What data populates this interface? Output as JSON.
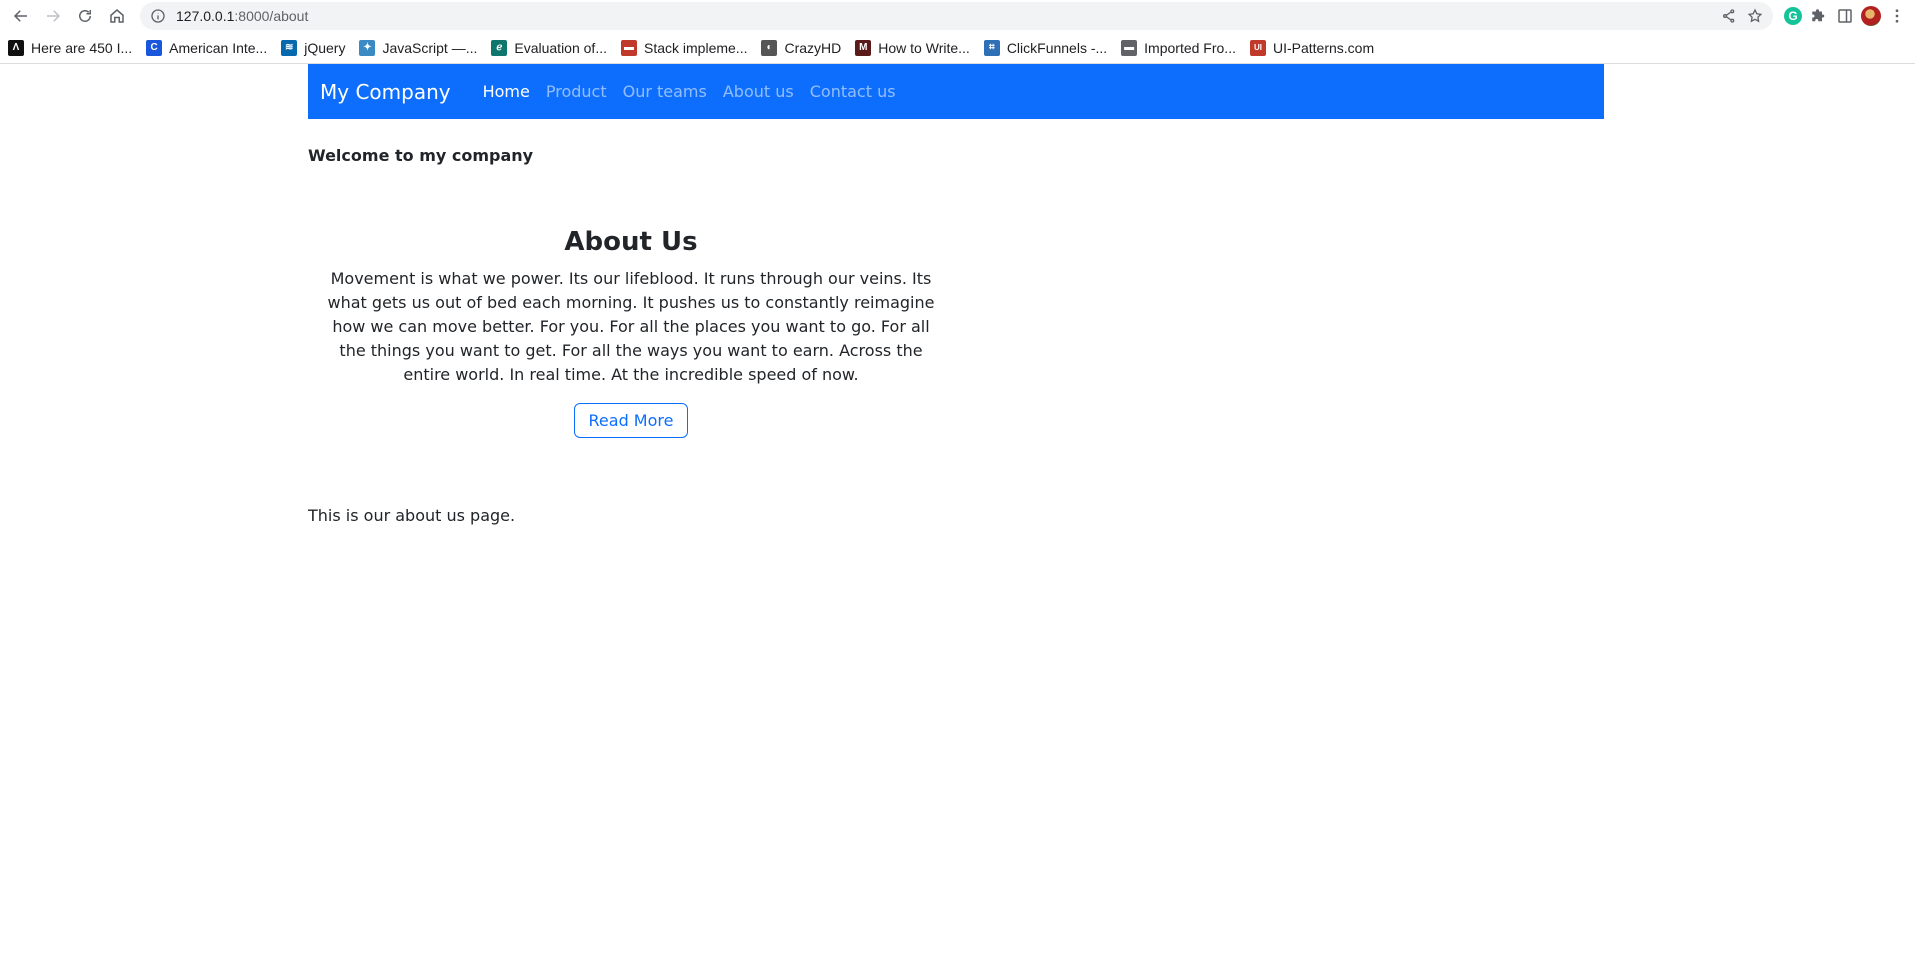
{
  "browser": {
    "url_host": "127.0.0.1",
    "url_path": ":8000/about",
    "bookmarks": [
      {
        "label": "Here are 450 I...",
        "icon": "black-square-favicon",
        "color": "#111111",
        "glyph": "Λ"
      },
      {
        "label": "American Inte...",
        "icon": "c-circle-favicon",
        "color": "#1a56db",
        "glyph": "C"
      },
      {
        "label": "jQuery",
        "icon": "jquery-favicon",
        "color": "#0769ad",
        "glyph": "≋"
      },
      {
        "label": "JavaScript —...",
        "icon": "bird-favicon",
        "color": "#3b8ac4",
        "glyph": "✦"
      },
      {
        "label": "Evaluation of...",
        "icon": "teal-circle-favicon",
        "color": "#0f766e",
        "glyph": "ℯ"
      },
      {
        "label": "Stack impleme...",
        "icon": "cup-favicon",
        "color": "#c0392b",
        "glyph": "▬"
      },
      {
        "label": "CrazyHD",
        "icon": "globe-favicon",
        "color": "#555555",
        "glyph": "◐"
      },
      {
        "label": "How to Write...",
        "icon": "dark-red-favicon",
        "color": "#5a1a1a",
        "glyph": "M"
      },
      {
        "label": "ClickFunnels -...",
        "icon": "clickfunnels-favicon",
        "color": "#2f6fb5",
        "glyph": "⌗"
      },
      {
        "label": "Imported Fro...",
        "icon": "folder-icon",
        "color": "#5f6368",
        "glyph": "▬"
      },
      {
        "label": "UI-Patterns.com",
        "icon": "ui-favicon",
        "color": "#c0392b",
        "glyph": "UI"
      }
    ]
  },
  "navbar": {
    "brand": "My Company",
    "links": [
      "Home",
      "Product",
      "Our teams",
      "About us",
      "Contact us"
    ]
  },
  "welcome": "Welcome to my company",
  "about": {
    "title": "About Us",
    "body": "Movement is what we power. Its our lifeblood. It runs through our veins. Its what gets us out of bed each morning. It pushes us to constantly reimagine how we can move better. For you. For all the places you want to go. For all the things you want to get. For all the ways you want to earn. Across the entire world. In real time. At the incredible speed of now.",
    "button": "Read More"
  },
  "footer_text": "This is our about us page.",
  "colors": {
    "primary": "#0d6efd",
    "nav_inactive": "rgba(255,255,255,0.55)"
  }
}
